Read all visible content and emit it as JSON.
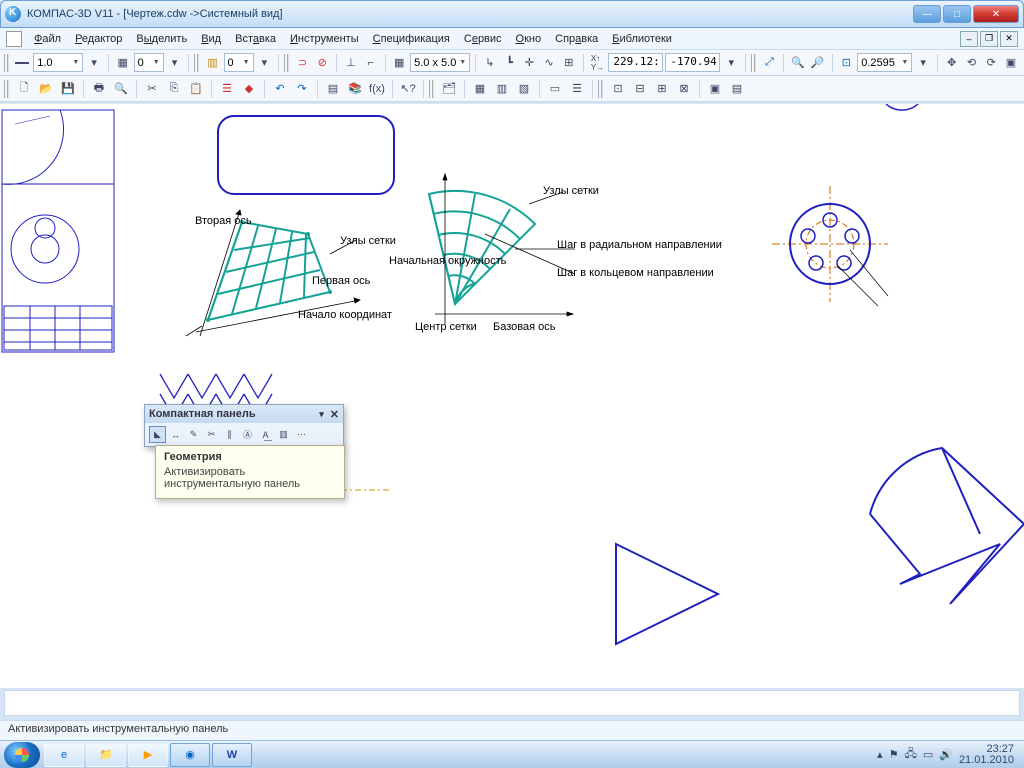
{
  "title": "КОМПАС-3D V11 - [Чертеж.cdw ->Системный вид]",
  "menu": {
    "file": "Файл",
    "edit": "Редактор",
    "select": "Выделить",
    "view": "Вид",
    "insert": "Вставка",
    "tools": "Инструменты",
    "spec": "Спецификация",
    "service": "Сервис",
    "window": "Окно",
    "help": "Справка",
    "libs": "Библиотеки"
  },
  "toolbar1": {
    "scale": "1.0",
    "step": "0",
    "grid": "5.0 x 5.0",
    "coord_x": "229.12:",
    "coord_y": "-170.94",
    "zoom": "0.2595"
  },
  "panel": {
    "title": "Компактная панель"
  },
  "tooltip": {
    "title": "Геометрия",
    "body": "Активизировать инструментальную панель"
  },
  "status": "Активизировать инструментальную панель",
  "tray": {
    "time": "23:27",
    "date": "21.01.2010"
  },
  "drawing_labels": {
    "grid_left_top": "Вторая ось",
    "grid_right": "Узлы сетки",
    "grid_bottom": "Первая ось",
    "grid_leader": "Начало координат",
    "fan_top": "Узлы сетки",
    "fan_r1": "Шаг в радиальном направлении",
    "fan_r2": "Шаг в кольцевом направлении",
    "fan_center": "Центр сетки",
    "fan_axis": "Базовая ось",
    "fan_left": "Начальная окружность"
  }
}
